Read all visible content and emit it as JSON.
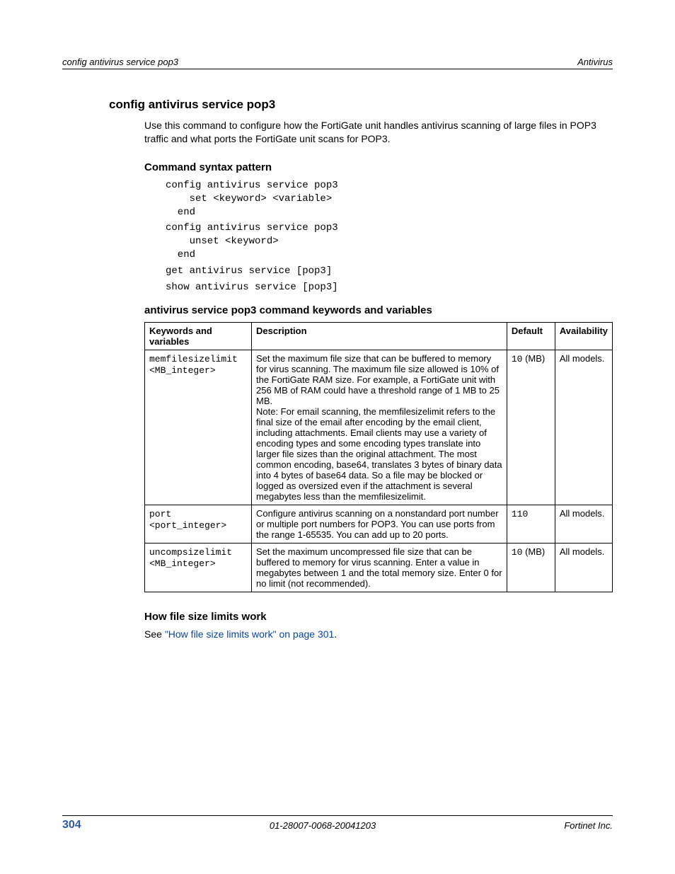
{
  "header": {
    "left": "config antivirus service pop3",
    "right": "Antivirus"
  },
  "section": {
    "title": "config antivirus service pop3",
    "intro": "Use this command to configure how the FortiGate unit handles antivirus scanning of large files in POP3 traffic and what ports the FortiGate unit scans for POP3."
  },
  "syntax": {
    "heading": "Command syntax pattern",
    "block1": "config antivirus service pop3\n    set <keyword> <variable>\n  end",
    "block2": "config antivirus service pop3\n    unset <keyword>\n  end",
    "line3": "get antivirus service [pop3]",
    "line4": "show antivirus service [pop3]"
  },
  "table": {
    "heading": "antivirus service pop3 command keywords and variables",
    "headers": {
      "kv": "Keywords and variables",
      "desc": "Description",
      "def": "Default",
      "avail": "Availability"
    },
    "rows": [
      {
        "kw1": "memfilesizelimit",
        "kw2": "<MB_integer>",
        "desc": "Set the maximum file size that can be buffered to memory for virus scanning. The maximum file size allowed is 10% of the FortiGate RAM size. For example, a FortiGate unit with 256 MB of RAM could have a threshold range of 1 MB to 25 MB.\nNote: For email scanning, the memfilesizelimit refers to the final size of the email after encoding by the email client, including attachments. Email clients may use a variety of encoding types and some encoding types translate into larger file sizes than the original attachment. The most common encoding, base64, translates 3 bytes of binary data into 4 bytes of base64 data. So a file may be blocked or logged as oversized even if the attachment is several megabytes less than the memfilesizelimit.",
        "def_mono": "10",
        "def_text": " (MB)",
        "avail": "All models."
      },
      {
        "kw1": "port",
        "kw2": "<port_integer>",
        "desc": "Configure antivirus scanning on a nonstandard port number or multiple port numbers for POP3. You can use ports from the range 1-65535. You can add up to 20 ports.",
        "def_mono": "110",
        "def_text": "",
        "avail": "All models."
      },
      {
        "kw1": "uncompsizelimit",
        "kw2": "<MB_integer>",
        "desc": "Set the maximum uncompressed file size that can be buffered to memory for virus scanning. Enter a value in megabytes between 1 and the total memory size. Enter 0 for no limit (not recommended).",
        "def_mono": "10",
        "def_text": " (MB)",
        "avail": "All models."
      }
    ]
  },
  "howworks": {
    "heading": "How file size limits work",
    "prefix": "See ",
    "link": "\"How file size limits work\" on page 301",
    "suffix": "."
  },
  "footer": {
    "page": "304",
    "mid": "01-28007-0068-20041203",
    "right": "Fortinet Inc."
  },
  "chart_data": {
    "type": "table",
    "title": "antivirus service pop3 command keywords and variables",
    "columns": [
      "Keywords and variables",
      "Description",
      "Default",
      "Availability"
    ],
    "rows": [
      [
        "memfilesizelimit <MB_integer>",
        "Set the maximum file size that can be buffered to memory for virus scanning. The maximum file size allowed is 10% of the FortiGate RAM size. For example, a FortiGate unit with 256 MB of RAM could have a threshold range of 1 MB to 25 MB. Note: For email scanning, the memfilesizelimit refers to the final size of the email after encoding by the email client, including attachments. Email clients may use a variety of encoding types and some encoding types translate into larger file sizes than the original attachment. The most common encoding, base64, translates 3 bytes of binary data into 4 bytes of base64 data. So a file may be blocked or logged as oversized even if the attachment is several megabytes less than the memfilesizelimit.",
        "10 (MB)",
        "All models."
      ],
      [
        "port <port_integer>",
        "Configure antivirus scanning on a nonstandard port number or multiple port numbers for POP3. You can use ports from the range 1-65535. You can add up to 20 ports.",
        "110",
        "All models."
      ],
      [
        "uncompsizelimit <MB_integer>",
        "Set the maximum uncompressed file size that can be buffered to memory for virus scanning. Enter a value in megabytes between 1 and the total memory size. Enter 0 for no limit (not recommended).",
        "10 (MB)",
        "All models."
      ]
    ]
  }
}
